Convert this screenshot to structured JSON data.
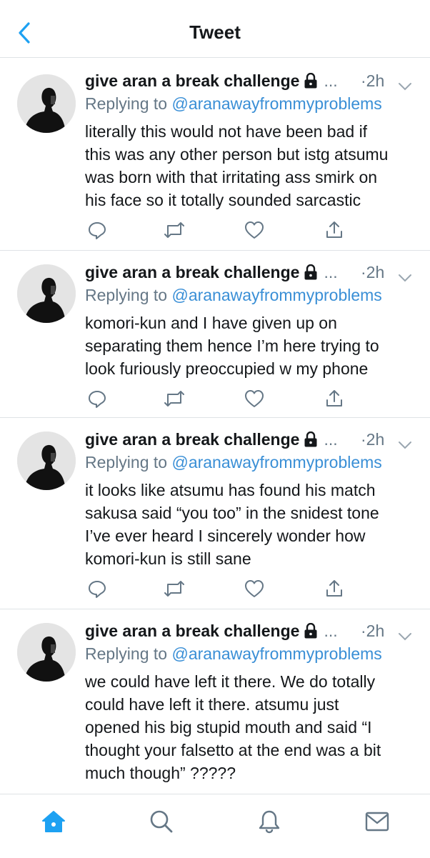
{
  "header": {
    "title": "Tweet"
  },
  "tweets": [
    {
      "name": "give aran a break challenge",
      "ellipsis": "...",
      "time": "·2h",
      "replying_prefix": "Replying to ",
      "replying_handle": "@aranawayfrommyproblems",
      "lines": [
        "literally this would not have been bad if",
        "this was any other person but istg atsumu",
        "was born with that irritating ass smirk on",
        "his face so it totally sounded sarcastic"
      ]
    },
    {
      "name": "give aran a break challenge",
      "ellipsis": "...",
      "time": "·2h",
      "replying_prefix": "Replying to ",
      "replying_handle": "@aranawayfrommyproblems",
      "lines": [
        "komori-kun and I have given up on",
        "separating them hence I’m here trying to",
        "look furiously preoccupied w my phone"
      ]
    },
    {
      "name": "give aran a break challenge",
      "ellipsis": "...",
      "time": "·2h",
      "replying_prefix": "Replying to ",
      "replying_handle": "@aranawayfrommyproblems",
      "lines": [
        "it looks like atsumu has found his match",
        "sakusa said “you too” in the snidest tone",
        "I’ve ever heard I sincerely wonder how",
        "komori-kun is still sane"
      ]
    },
    {
      "name": "give aran a break challenge",
      "ellipsis": "...",
      "time": "·2h",
      "replying_prefix": "Replying to ",
      "replying_handle": "@aranawayfrommyproblems",
      "lines": [
        "we could have left it there. We do totally",
        "could have left it there. atsumu just",
        "opened his big stupid mouth and said “I",
        "thought your falsetto at the end was a bit",
        "much though” ?????"
      ]
    }
  ],
  "icons": {
    "back": "chevron-left-icon",
    "lock": "lock-icon",
    "caret": "chevron-down-icon",
    "reply": "reply-icon",
    "retweet": "retweet-icon",
    "like": "heart-icon",
    "share": "share-icon",
    "home": "home-icon",
    "search": "search-icon",
    "notifications": "bell-icon",
    "messages": "mail-icon"
  },
  "colors": {
    "accent": "#1da1f2",
    "handle": "#3a8fd6",
    "muted": "#657786",
    "text": "#14171a"
  }
}
